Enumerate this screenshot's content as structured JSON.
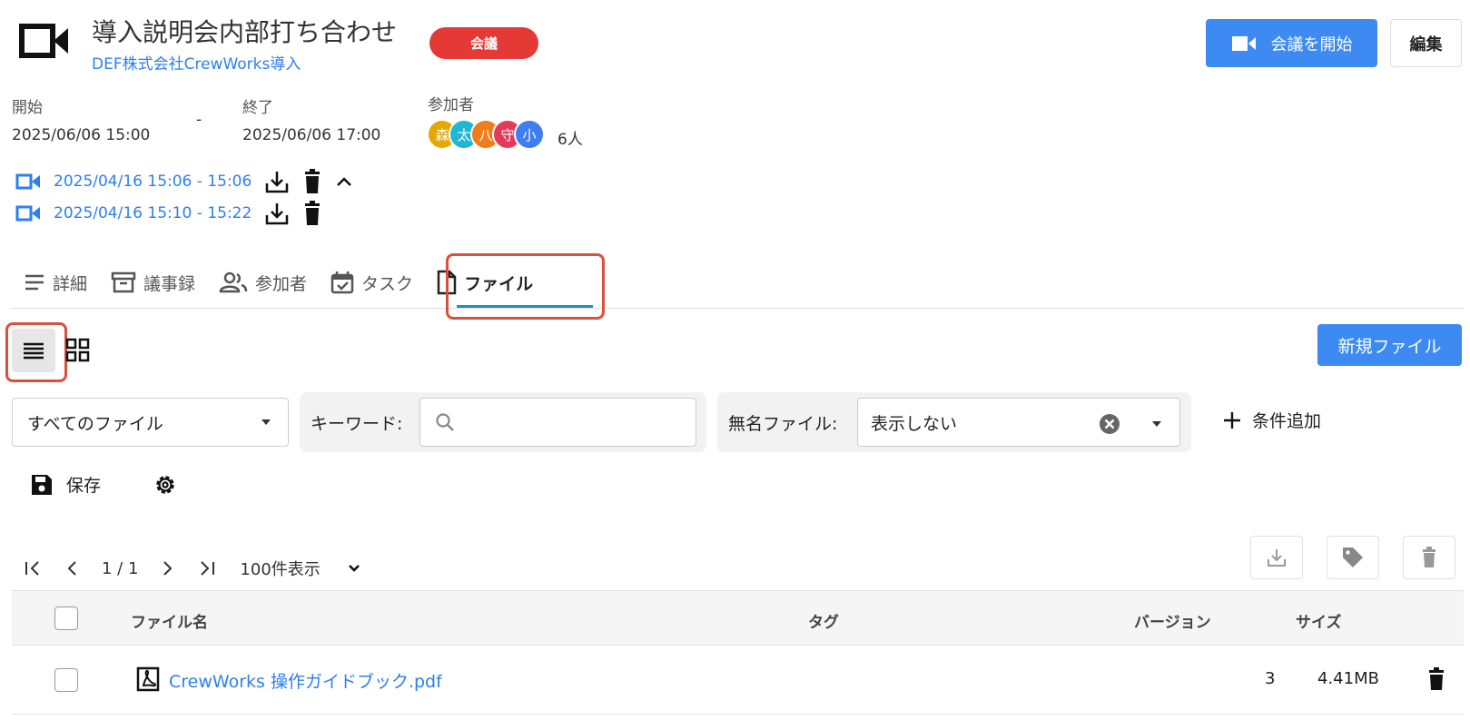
{
  "header": {
    "title": "導入説明会内部打ち合わせ",
    "subtitle": "DEF株式会社CrewWorks導入",
    "badge": "会議",
    "start_button": "会議を開始",
    "edit_button": "編集"
  },
  "schedule": {
    "start_label": "開始",
    "start_value": "2025/06/06 15:00",
    "separator": "-",
    "end_label": "終了",
    "end_value": "2025/06/06 17:00",
    "participants_label": "参加者",
    "participants_count": "6人",
    "avatars": [
      {
        "char": "森",
        "color": "#e6a700"
      },
      {
        "char": "太",
        "color": "#1fb8d3"
      },
      {
        "char": "八",
        "color": "#f07c1a"
      },
      {
        "char": "守",
        "color": "#e53958"
      },
      {
        "char": "小",
        "color": "#3d7ef0"
      }
    ]
  },
  "recordings": [
    {
      "time": "2025/04/16 15:06 - 15:06"
    },
    {
      "time": "2025/04/16 15:10 - 15:22"
    }
  ],
  "tabs": [
    {
      "label": "詳細",
      "icon": "lines-icon"
    },
    {
      "label": "議事録",
      "icon": "archive-icon"
    },
    {
      "label": "参加者",
      "icon": "people-icon"
    },
    {
      "label": "タスク",
      "icon": "calendar-check-icon"
    },
    {
      "label": "ファイル",
      "icon": "file-icon",
      "active": true
    }
  ],
  "toolbar": {
    "new_file": "新規ファイル",
    "save": "保存"
  },
  "filters": {
    "file_scope": "すべてのファイル",
    "keyword_label": "キーワード:",
    "unnamed_label": "無名ファイル:",
    "unnamed_value": "表示しない",
    "add_condition": "条件追加"
  },
  "pager": {
    "page": "1 / 1",
    "per_page": "100件表示"
  },
  "table": {
    "columns": {
      "name": "ファイル名",
      "tag": "タグ",
      "version": "バージョン",
      "size": "サイズ"
    },
    "rows": [
      {
        "name": "CrewWorks 操作ガイドブック.pdf",
        "tag": "",
        "version": "3",
        "size": "4.41MB"
      }
    ]
  },
  "colors": {
    "accent": "#3d8bf2",
    "link": "#2d7ff0",
    "badge": "#e53935",
    "highlight": "#d9503f",
    "tab_underline": "#1593c7"
  }
}
